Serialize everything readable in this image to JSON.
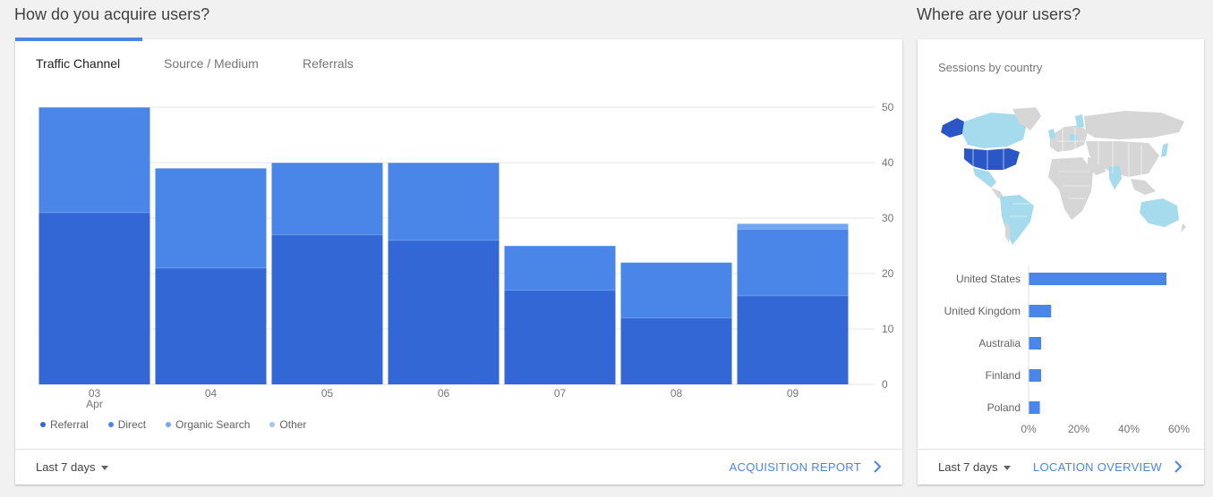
{
  "left_section": {
    "title": "How do you acquire users?",
    "tabs": [
      "Traffic Channel",
      "Source / Medium",
      "Referrals"
    ],
    "footer": {
      "range": "Last 7 days",
      "link": "ACQUISITION REPORT"
    }
  },
  "right_section": {
    "title": "Where are your users?",
    "subtitle": "Sessions by country",
    "footer": {
      "range": "Last 7 days",
      "link": "LOCATION OVERVIEW"
    }
  },
  "colors": {
    "referral": "#3367d6",
    "direct": "#4a86e8",
    "organic": "#6fa8f0",
    "other": "#a4c2f4",
    "map_high": "#2a56c6",
    "map_mid": "#a6dbed",
    "map_none": "#d6d6d6"
  },
  "chart_data": [
    {
      "type": "bar",
      "stacked": true,
      "categories": [
        "03\nApr",
        "04",
        "05",
        "06",
        "07",
        "08",
        "09"
      ],
      "series": [
        {
          "name": "Referral",
          "values": [
            31,
            21,
            27,
            26,
            17,
            12,
            16
          ]
        },
        {
          "name": "Direct",
          "values": [
            19,
            18,
            13,
            14,
            8,
            10,
            12
          ]
        },
        {
          "name": "Organic Search",
          "values": [
            0,
            0,
            0,
            0,
            0,
            0,
            1
          ]
        },
        {
          "name": "Other",
          "values": [
            0,
            0,
            0,
            0,
            0,
            0,
            0
          ]
        }
      ],
      "ylim": [
        0,
        50
      ],
      "yticks": [
        0,
        10,
        20,
        30,
        40,
        50
      ],
      "grid": true,
      "y_axis_side": "right",
      "legend": "bottom-left"
    },
    {
      "type": "bar",
      "orientation": "horizontal",
      "categories": [
        "United States",
        "United Kingdom",
        "Australia",
        "Finland",
        "Poland"
      ],
      "values": [
        0.55,
        0.09,
        0.05,
        0.05,
        0.045
      ],
      "xlim": [
        0,
        0.6
      ],
      "xticks": [
        "0%",
        "20%",
        "40%",
        "60%"
      ],
      "grid": false
    }
  ]
}
